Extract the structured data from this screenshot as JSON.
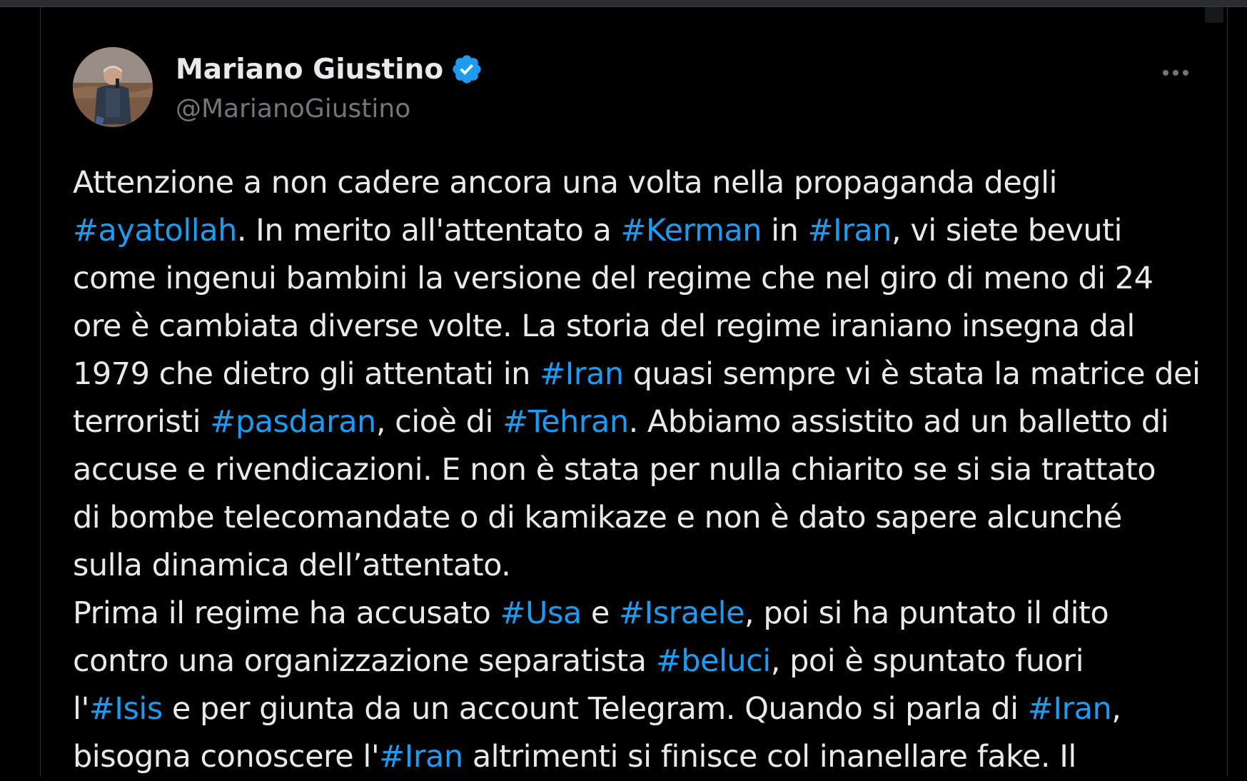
{
  "tweet": {
    "author": {
      "name": "Mariano Giustino",
      "handle": "@MarianoGiustino",
      "verified": true,
      "avatar_icon": "user-photo-avatar"
    },
    "more_icon": "more-horizontal-icon",
    "colors": {
      "background": "#000000",
      "text": "#e7e9ea",
      "muted": "#71767b",
      "hashtag": "#1d9bf0",
      "verified": "#1d9bf0"
    },
    "lines": [
      [
        {
          "t": "Attenzione a non cadere ancora una volta nella propaganda degli"
        }
      ],
      [
        {
          "t": "#ayatollah",
          "h": true
        },
        {
          "t": ". In merito all'attentato a "
        },
        {
          "t": "#Kerman",
          "h": true
        },
        {
          "t": " in "
        },
        {
          "t": "#Iran",
          "h": true
        },
        {
          "t": ", vi siete bevuti"
        }
      ],
      [
        {
          "t": "come ingenui bambini la versione del regime che nel giro di meno di 24"
        }
      ],
      [
        {
          "t": "ore è cambiata diverse volte. La storia del regime iraniano insegna dal"
        }
      ],
      [
        {
          "t": "1979 che dietro gli attentati in "
        },
        {
          "t": "#Iran",
          "h": true
        },
        {
          "t": " quasi sempre vi è stata la matrice dei"
        }
      ],
      [
        {
          "t": "terroristi "
        },
        {
          "t": "#pasdaran",
          "h": true
        },
        {
          "t": ", cioè di "
        },
        {
          "t": "#Tehran",
          "h": true
        },
        {
          "t": ". Abbiamo assistito ad un balletto di"
        }
      ],
      [
        {
          "t": "accuse e rivendicazioni. E non è stata per nulla chiarito se si sia trattato"
        }
      ],
      [
        {
          "t": "di bombe telecomandate o di kamikaze e non è dato sapere alcunché"
        }
      ],
      [
        {
          "t": "sulla dinamica dell’attentato."
        }
      ],
      [
        {
          "t": "Prima il regime ha accusato "
        },
        {
          "t": "#Usa",
          "h": true
        },
        {
          "t": " e "
        },
        {
          "t": "#Israele",
          "h": true
        },
        {
          "t": ", poi si ha puntato il dito"
        }
      ],
      [
        {
          "t": "contro una organizzazione separatista "
        },
        {
          "t": "#beluci",
          "h": true
        },
        {
          "t": ", poi è spuntato fuori"
        }
      ],
      [
        {
          "t": "l'"
        },
        {
          "t": "#Isis",
          "h": true
        },
        {
          "t": " e per giunta da un account Telegram. Quando si parla di "
        },
        {
          "t": "#Iran",
          "h": true
        },
        {
          "t": ","
        }
      ],
      [
        {
          "t": "bisogna conoscere l'"
        },
        {
          "t": "#Iran",
          "h": true
        },
        {
          "t": " altrimenti si finisce col inanellare fake. Il"
        }
      ]
    ]
  }
}
